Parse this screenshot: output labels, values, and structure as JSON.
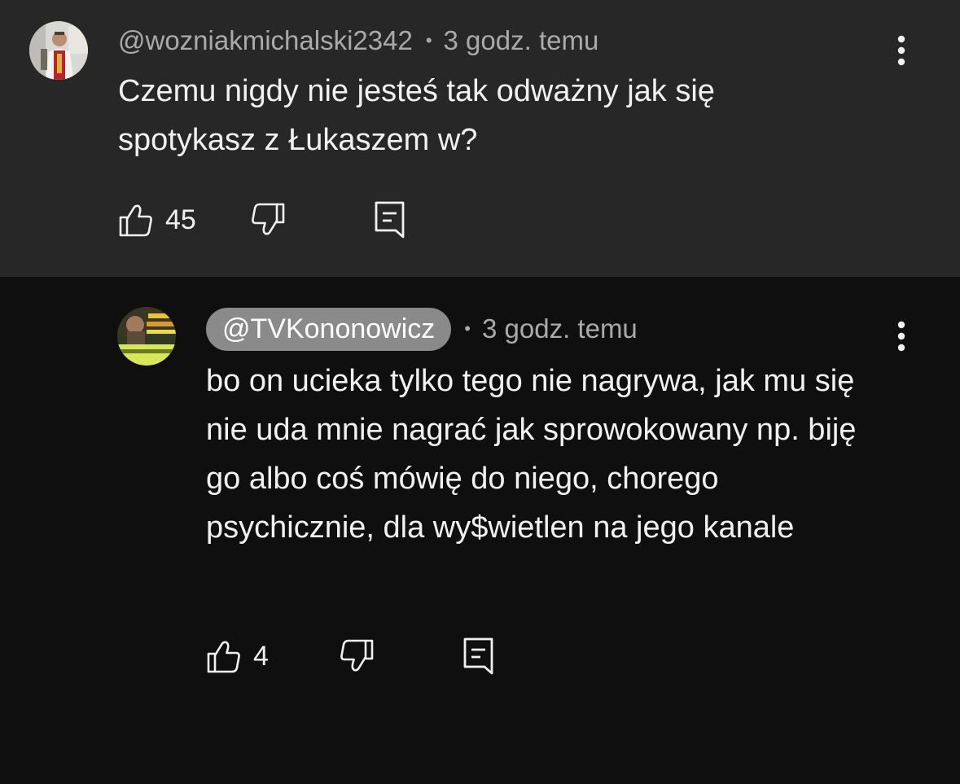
{
  "comments": [
    {
      "author": "@wozniakmichalski2342",
      "separator": "•",
      "time": "3 godz. temu",
      "text": "Czemu nigdy nie jesteś tak odważny jak się spotykasz z Łukaszem w?",
      "likes": "45",
      "author_highlighted": false
    },
    {
      "author": "@TVKononowicz",
      "separator": "•",
      "time": "3 godz. temu",
      "text": "bo on ucieka tylko tego nie nagrywa, jak mu się nie uda mnie nagrać jak sprowokowany np. biję go albo coś mówię do niego, chorego psychicznie, dla wy$wietlen na jego kanale",
      "likes": "4",
      "author_highlighted": true
    }
  ],
  "icons": {
    "like": "thumbs-up-icon",
    "dislike": "thumbs-down-icon",
    "reply": "reply-comment-icon",
    "more": "more-vertical-icon"
  },
  "colors": {
    "parent_background": "#272727",
    "reply_background": "#0f0f0f",
    "text": "#f1f1f1",
    "meta": "#aaaaaa",
    "author_pill": "#8a8a8a"
  }
}
